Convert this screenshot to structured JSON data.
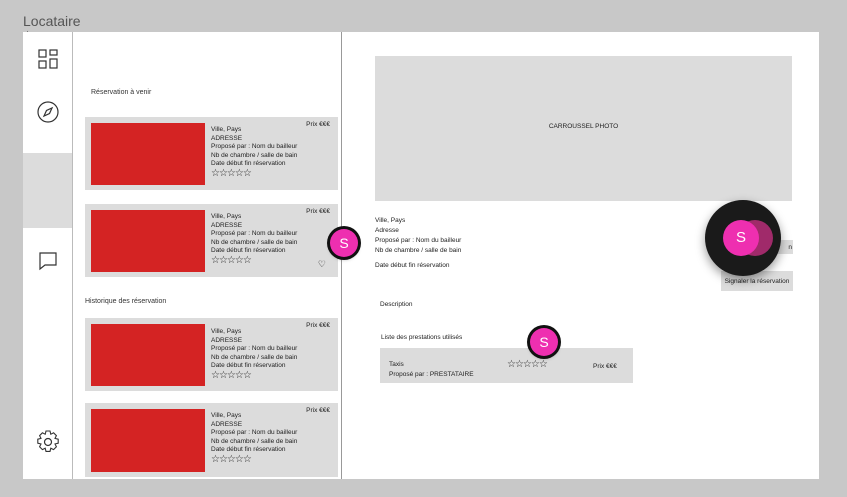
{
  "app": {
    "title": "Locataire"
  },
  "sidebar": {
    "icons": [
      "dashboard-icon",
      "compass-icon",
      "active-slot",
      "chat-icon",
      "settings-icon"
    ]
  },
  "upcoming": {
    "label": "Réservation  à venir",
    "cards": [
      {
        "city": "Ville, Pays",
        "address": "ADRESSE",
        "proposed": "Proposé par : Nom du bailleur",
        "rooms": "Nb de chambre / salle de bain",
        "dates": "Date début fin réservation",
        "price": "Prix €€€",
        "stars": "☆☆☆☆☆"
      },
      {
        "city": "Ville, Pays",
        "address": "ADRESSE",
        "proposed": "Proposé par : Nom du bailleur",
        "rooms": "Nb de chambre / salle de bain",
        "dates": "Date début fin réservation",
        "price": "Prix €€€",
        "stars": "☆☆☆☆☆"
      }
    ]
  },
  "history": {
    "label": "Historique des réservation",
    "cards": [
      {
        "city": "Ville, Pays",
        "address": "ADRESSE",
        "proposed": "Proposé par : Nom du bailleur",
        "rooms": "Nb de chambre / salle de bain",
        "dates": "Date début fin réservation",
        "price": "Prix €€€",
        "stars": "☆☆☆☆☆"
      },
      {
        "city": "Ville, Pays",
        "address": "ADRESSE",
        "proposed": "Proposé par : Nom du bailleur",
        "rooms": "Nb de chambre / salle de bain",
        "dates": "Date début fin réservation",
        "price": "Prix €€€",
        "stars": "☆☆☆☆☆"
      }
    ]
  },
  "detail": {
    "carousel": "CARROUSSEL PHOTO",
    "city": "Ville, Pays",
    "address": "Adresse",
    "proposed": "Proposé par : Nom du bailleur",
    "rooms": "Nb de chambre  / salle de bain",
    "dates": "Date début fin réservation",
    "description": "Description",
    "services_label": "Liste des prestations utilisés",
    "contact_partial": "n",
    "report_button": "Signaler la réservation",
    "service": {
      "name": "Taxis",
      "proposed": "Proposé par : PRESTATAIRE",
      "price": "Prix €€€",
      "stars": "☆☆☆☆☆"
    }
  },
  "avatars": {
    "letter": "S"
  },
  "colors": {
    "accent": "#ee2fb0",
    "image": "#d42323",
    "card": "#dcdcdc"
  }
}
